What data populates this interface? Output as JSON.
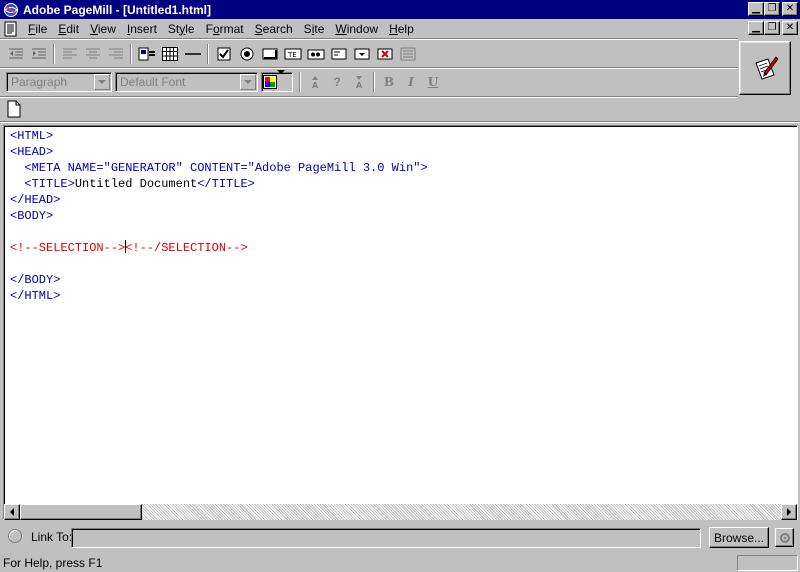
{
  "window": {
    "title": "Adobe PageMill - [Untitled1.html]",
    "app_icon": "pagemill-globe-icon"
  },
  "menubar": {
    "items": [
      {
        "label": "File",
        "key": "F",
        "rest": "ile"
      },
      {
        "label": "Edit",
        "key": "E",
        "rest": "dit"
      },
      {
        "label": "View",
        "key": "V",
        "rest": "iew"
      },
      {
        "label": "Insert",
        "key": "I",
        "rest": "nsert"
      },
      {
        "label": "Style",
        "pre": "St",
        "key": "y",
        "rest": "le"
      },
      {
        "label": "Format",
        "pre": "F",
        "key": "o",
        "rest": "rmat"
      },
      {
        "label": "Search",
        "key": "S",
        "rest": "earch"
      },
      {
        "label": "Site",
        "pre": "S",
        "key": "i",
        "rest": "te"
      },
      {
        "label": "Window",
        "key": "W",
        "rest": "indow"
      },
      {
        "label": "Help",
        "key": "H",
        "rest": "elp"
      }
    ]
  },
  "toolbar2": {
    "paragraph_combo": "Paragraph",
    "font_combo": "Default Font",
    "help_glyph": "?",
    "bold": "B",
    "italic": "I",
    "underline": "U"
  },
  "editor": {
    "lines": [
      [
        {
          "t": "<HTML>",
          "c": "tag"
        }
      ],
      [
        {
          "t": "<HEAD>",
          "c": "tag"
        }
      ],
      [
        {
          "t": "  <META NAME=\"GENERATOR\" CONTENT=\"Adobe PageMill 3.0 Win\">",
          "c": "tag"
        }
      ],
      [
        {
          "t": "  <TITLE>",
          "c": "tag"
        },
        {
          "t": "Untitled Document",
          "c": "plain"
        },
        {
          "t": "</TITLE>",
          "c": "tag"
        }
      ],
      [
        {
          "t": "</HEAD>",
          "c": "tag"
        }
      ],
      [
        {
          "t": "<BODY>",
          "c": "tag"
        }
      ],
      [
        {
          "t": "",
          "c": "plain"
        }
      ],
      [
        {
          "t": "<!--SELECTION-->",
          "c": "red"
        },
        {
          "caret": true
        },
        {
          "t": "<!--/SELECTION-->",
          "c": "red"
        }
      ],
      [
        {
          "t": "",
          "c": "plain"
        }
      ],
      [
        {
          "t": "</BODY>",
          "c": "tag"
        }
      ],
      [
        {
          "t": "</HTML>",
          "c": "tag"
        }
      ]
    ]
  },
  "linkbar": {
    "label": "Link To:",
    "value": "",
    "browse_label": "Browse..."
  },
  "statusbar": {
    "text": "For Help, press F1"
  }
}
